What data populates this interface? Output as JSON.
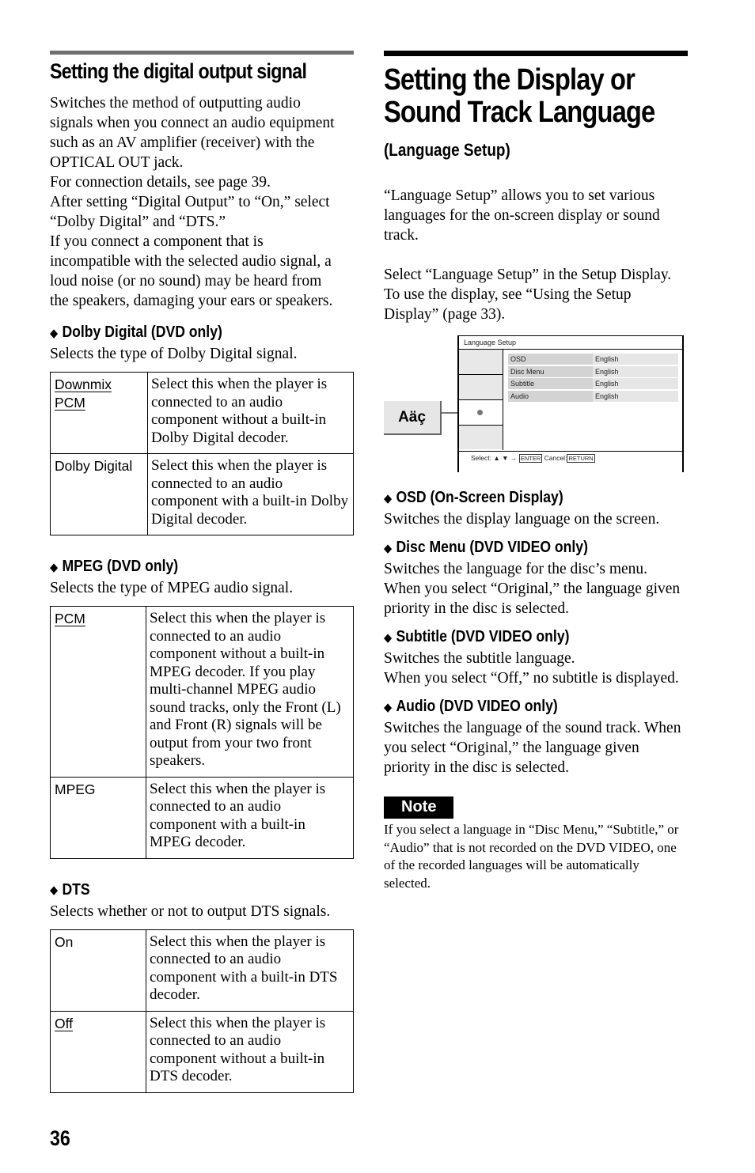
{
  "page_number": "36",
  "left": {
    "section_title": "Setting the digital output signal",
    "intro_lines": [
      "Switches the method of outputting audio",
      "signals when you connect an audio equipment",
      "such as an AV amplifier (receiver) with the",
      "OPTICAL OUT jack.",
      "For connection details, see page 39.",
      "After setting “Digital Output” to “On,” select",
      "“Dolby Digital” and “DTS.”",
      "If you connect a component that is",
      "incompatible with the selected audio signal, a",
      "loud noise (or no sound) may be heard from",
      "the speakers, damaging your ears or speakers."
    ],
    "subsections": [
      {
        "title": "Dolby Digital (DVD only)",
        "description": "Selects the type of Dolby Digital signal.",
        "options": [
          {
            "name_lines": [
              "Downmix",
              "PCM"
            ],
            "default": true,
            "text": "Select this when the player is connected to an audio component without a built-in Dolby Digital decoder."
          },
          {
            "name_lines": [
              "Dolby Digital"
            ],
            "default": false,
            "text": "Select this when the player is connected to an audio component with a built-in Dolby Digital decoder."
          }
        ]
      },
      {
        "title": "MPEG (DVD only)",
        "description": "Selects the type of MPEG audio signal.",
        "options": [
          {
            "name_lines": [
              "PCM"
            ],
            "default": true,
            "text": "Select this when the player is connected to an audio component without a built-in MPEG decoder. If you play multi-channel MPEG audio sound tracks, only the Front (L) and Front (R) signals will be output from your two front speakers."
          },
          {
            "name_lines": [
              "MPEG"
            ],
            "default": false,
            "text": "Select this when the player is connected to an audio component with a built-in MPEG decoder."
          }
        ]
      },
      {
        "title": "DTS",
        "description": "Selects whether or not to output DTS signals.",
        "options": [
          {
            "name_lines": [
              "On"
            ],
            "default": false,
            "text": "Select this when the player is connected to an audio component with a built-in DTS decoder."
          },
          {
            "name_lines": [
              "Off"
            ],
            "default": true,
            "text": "Select this when the player is connected to an audio component without a built-in DTS decoder."
          }
        ]
      }
    ]
  },
  "right": {
    "title_lines": [
      "Setting the Display or",
      "Sound Track Language"
    ],
    "subtitle": "(Language Setup)",
    "para1": "“Language Setup” allows you to set various languages for the on-screen display or sound track.",
    "para2": "Select “Language Setup” in the Setup Display. To use the display, see “Using the Setup Display” (page 33).",
    "setup_display": {
      "icon_glyph": "Aäç",
      "title": "Language Setup",
      "rows": [
        {
          "name": "OSD",
          "value": "English"
        },
        {
          "name": "Disc Menu",
          "value": "English"
        },
        {
          "name": "Subtitle",
          "value": "English"
        },
        {
          "name": "Audio",
          "value": "English"
        }
      ],
      "footer_select": "Select:",
      "footer_arrows": "▲ ▼ →",
      "footer_enter": "ENTER",
      "footer_cancel": "Cancel:",
      "footer_return": "RETURN"
    },
    "items": [
      {
        "title": "OSD (On-Screen Display)",
        "text": "Switches the display language on the screen."
      },
      {
        "title": "Disc Menu (DVD VIDEO only)",
        "text": "Switches the language for the disc’s menu. When you select “Original,” the language given priority in the disc is selected."
      },
      {
        "title": "Subtitle (DVD VIDEO only)",
        "text": "Switches the subtitle language.\nWhen you select “Off,” no subtitle is displayed."
      },
      {
        "title": "Audio (DVD VIDEO only)",
        "text": "Switches the language of the sound track. When you select “Original,” the language given priority in the disc is selected."
      }
    ],
    "note_label": "Note",
    "note_text": "If you select a language in “Disc Menu,” “Subtitle,” or “Audio” that is not recorded on the DVD VIDEO, one of the recorded languages will be automatically selected."
  }
}
